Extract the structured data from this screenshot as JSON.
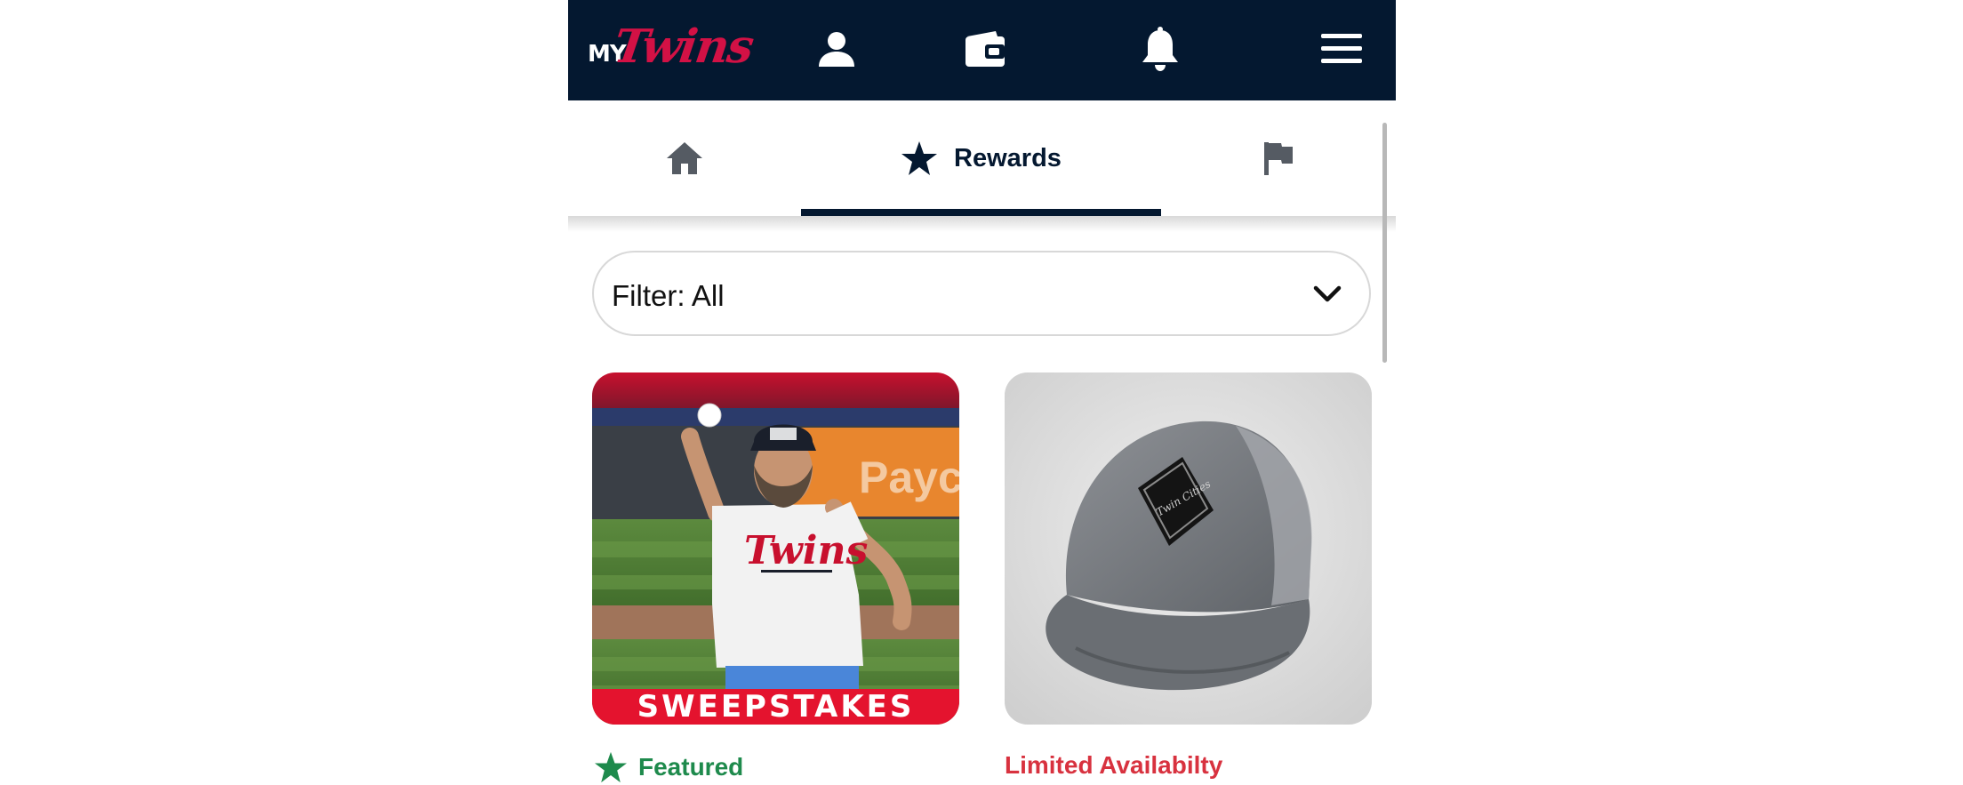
{
  "header": {
    "logo_prefix": "MY",
    "logo_word": "Twins",
    "icons": [
      "person-icon",
      "wallet-icon",
      "bell-icon",
      "menu-icon"
    ]
  },
  "tabs": [
    {
      "icon": "home-icon",
      "label": ""
    },
    {
      "icon": "star-icon",
      "label": "Rewards",
      "active": true
    },
    {
      "icon": "flag-icon",
      "label": ""
    }
  ],
  "filter": {
    "label": "Filter: All",
    "icon": "chevron-down-icon"
  },
  "cards": [
    {
      "banner": "SWEEPSTAKES",
      "jersey_text": "Twins",
      "status": "Featured",
      "status_icon": "star-icon",
      "status_color": "#1e8a4c"
    },
    {
      "patch_text": "Twin Cities",
      "status": "Limited Availabilty",
      "status_color": "#d8323f"
    }
  ],
  "colors": {
    "navy": "#041830",
    "brand_red": "#d31145",
    "featured_green": "#1e8a4c",
    "limited_red": "#d8323f"
  }
}
